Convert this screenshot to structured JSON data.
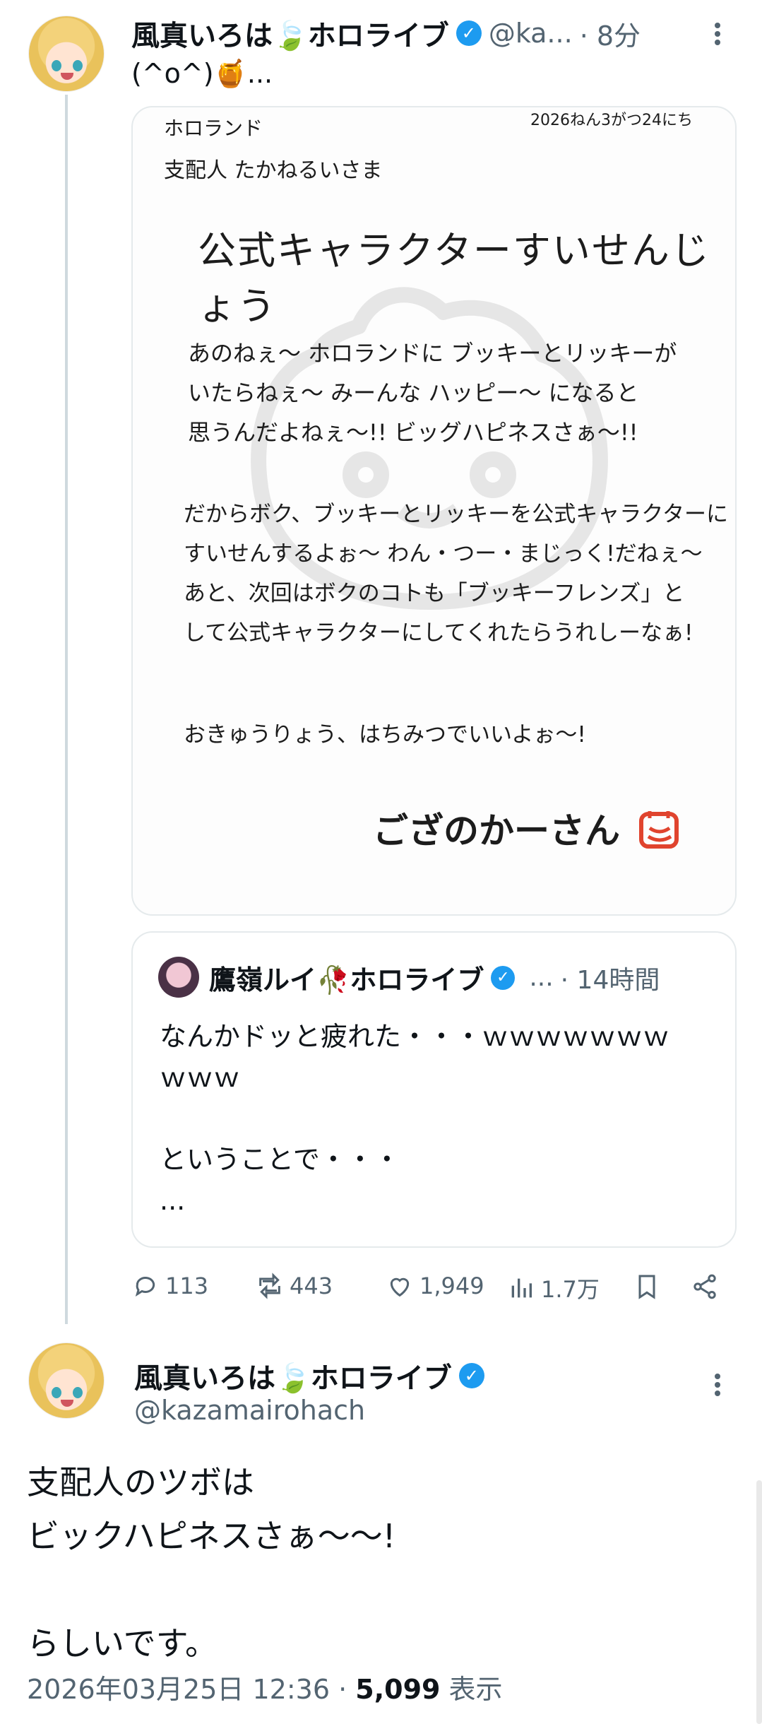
{
  "tweet": {
    "author_name": "風真いろは🍃ホロライブ",
    "handle": "@ka...",
    "time": "· 8分",
    "text": "(^o^)🍯...",
    "letter": {
      "header_left": "ホロランド",
      "header_date": "2026ねん3がつ24にち",
      "addressee": "支配人 たかねるいさま",
      "title": "公式キャラクターすいせんじょう",
      "para1": [
        "あのねぇ〜 ホロランドに ブッキーとリッキーが",
        "いたらねぇ〜 みーんな ハッピー〜 になると",
        "思うんだよねぇ〜!! ビッグハピネスさぁ〜!!"
      ],
      "para2": [
        "だからボク、ブッキーとリッキーを公式キャラクターに",
        "すいせんするよぉ〜 わん・つー・まじっく!だねぇ〜",
        "あと、次回はボクのコトも「ブッキーフレンズ」と",
        "して公式キャラクターにしてくれたらうれしーなぁ!"
      ],
      "para3": "おきゅうりょう、はちみつでいいよぉ〜!",
      "signature": "ござのかーさん"
    },
    "quote": {
      "author_name": "鷹嶺ルイ🥀ホロライブ",
      "handle_ellipsis": "...",
      "time": "· 14時間",
      "line1": "なんかドッと疲れた・・・ｗｗｗｗｗｗｗ",
      "line2": "ｗｗｗ",
      "line3": "ということで・・・",
      "line4": "..."
    },
    "actions": {
      "replies": "113",
      "retweets": "443",
      "likes": "1,949",
      "views": "1.7万"
    }
  },
  "reply": {
    "author_name": "風真いろは🍃ホロライブ",
    "handle": "@kazamairohach",
    "line1": "支配人のツボは",
    "line2": "ビックハピネスさぁ〜〜!",
    "line3": "らしいです。",
    "timestamp": "2026年03月25日 12:36 · ",
    "views_count": "5,099",
    "views_label": " 表示"
  },
  "colors": {
    "verified": "#1d9bf0",
    "muted": "#536471",
    "border": "#e5eaec",
    "stamp": "#e0442e"
  }
}
